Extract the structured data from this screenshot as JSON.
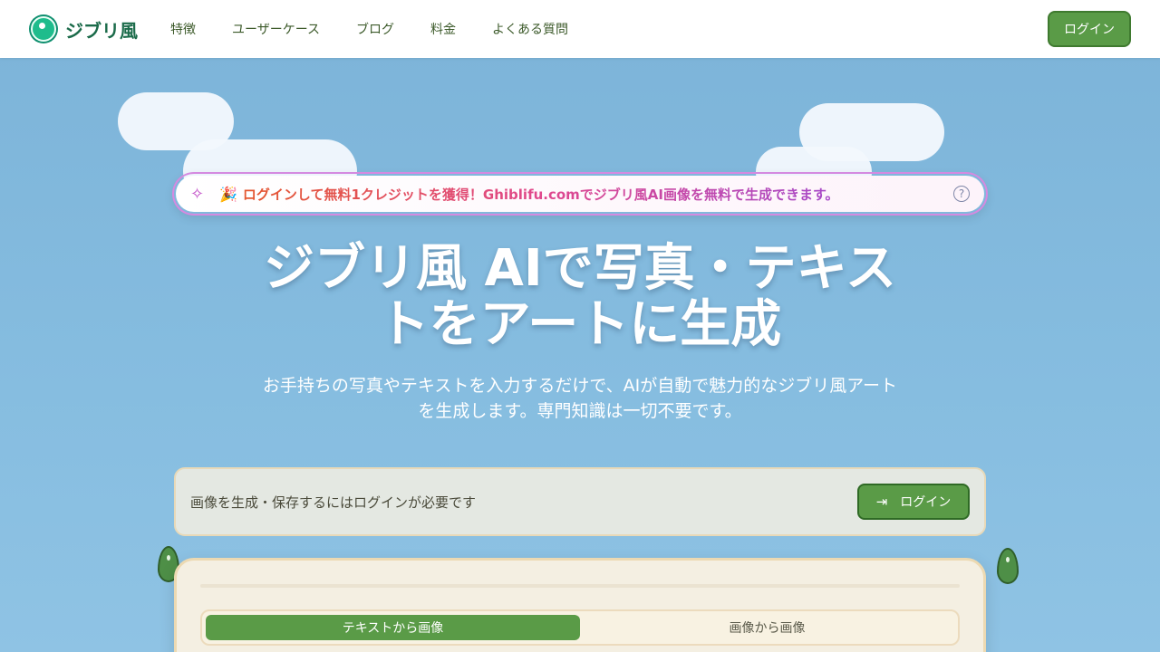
{
  "header": {
    "logo_text": "ジブリ風",
    "nav": [
      "特徴",
      "ユーザーケース",
      "ブログ",
      "料金",
      "よくある質問"
    ],
    "login_label": "ログイン"
  },
  "banner": {
    "text": "ログインして無料1クレジットを獲得！Ghiblifu.comでジブリ風AI画像を無料で生成できます。",
    "sparkle_icon": "✧",
    "party_icon": "🎉",
    "help_icon": "?"
  },
  "hero": {
    "title_line1": "ジブリ風 AIで写真・テキス",
    "title_line2": "トをアートに生成",
    "subtitle_line1": "お手持ちの写真やテキストを入力するだけで、AIが自動で魅力的なジブリ風アート",
    "subtitle_line2": "を生成します。専門知識は一切不要です。"
  },
  "notice": {
    "text": "画像を生成・保存するにはログインが必要です",
    "login_label": "ログイン",
    "login_icon": "⇥"
  },
  "card": {
    "tabs": [
      {
        "label": "テキストから画像",
        "active": true
      },
      {
        "label": "画像から画像",
        "active": false
      }
    ]
  },
  "colors": {
    "accent_green": "#5a9b47",
    "sky_blue": "#7cb3d8",
    "card_bg": "#f4efe2"
  }
}
